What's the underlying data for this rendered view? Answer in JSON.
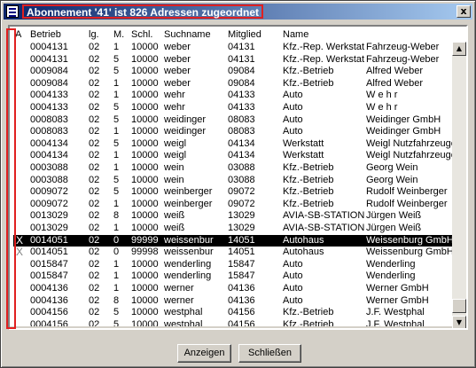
{
  "window": {
    "title": "Abonnement '41' ist 826 Adressen zugeordnet",
    "close_symbol": "x"
  },
  "columns": {
    "a": "A",
    "betrieb": "Betrieb",
    "lg": "lg.",
    "m": "M.",
    "schl": "Schl.",
    "suchname": "Suchname",
    "mitglied": "Mitglied",
    "name": "Name"
  },
  "rows": [
    {
      "a": "",
      "betrieb": "0004131",
      "lg": "02",
      "m": "1",
      "schl": "10000",
      "suchname": "weber",
      "mitglied": "04131",
      "name": "Kfz.-Rep. Werkstat",
      "extra": "Fahrzeug-Weber"
    },
    {
      "a": "",
      "betrieb": "0004131",
      "lg": "02",
      "m": "5",
      "schl": "10000",
      "suchname": "weber",
      "mitglied": "04131",
      "name": "Kfz.-Rep. Werkstat",
      "extra": "Fahrzeug-Weber"
    },
    {
      "a": "",
      "betrieb": "0009084",
      "lg": "02",
      "m": "5",
      "schl": "10000",
      "suchname": "weber",
      "mitglied": "09084",
      "name": "Kfz.-Betrieb",
      "extra": "Alfred Weber"
    },
    {
      "a": "",
      "betrieb": "0009084",
      "lg": "02",
      "m": "1",
      "schl": "10000",
      "suchname": "weber",
      "mitglied": "09084",
      "name": "Kfz.-Betrieb",
      "extra": "Alfred Weber"
    },
    {
      "a": "",
      "betrieb": "0004133",
      "lg": "02",
      "m": "1",
      "schl": "10000",
      "suchname": "wehr",
      "mitglied": "04133",
      "name": "Auto",
      "extra": "W e h r"
    },
    {
      "a": "",
      "betrieb": "0004133",
      "lg": "02",
      "m": "5",
      "schl": "10000",
      "suchname": "wehr",
      "mitglied": "04133",
      "name": "Auto",
      "extra": "W e h r"
    },
    {
      "a": "",
      "betrieb": "0008083",
      "lg": "02",
      "m": "5",
      "schl": "10000",
      "suchname": "weidinger",
      "mitglied": "08083",
      "name": "Auto",
      "extra": "Weidinger GmbH"
    },
    {
      "a": "",
      "betrieb": "0008083",
      "lg": "02",
      "m": "1",
      "schl": "10000",
      "suchname": "weidinger",
      "mitglied": "08083",
      "name": "Auto",
      "extra": "Weidinger GmbH"
    },
    {
      "a": "",
      "betrieb": "0004134",
      "lg": "02",
      "m": "5",
      "schl": "10000",
      "suchname": "weigl",
      "mitglied": "04134",
      "name": "Werkstatt",
      "extra": "Weigl Nutzfahrzeuge"
    },
    {
      "a": "",
      "betrieb": "0004134",
      "lg": "02",
      "m": "1",
      "schl": "10000",
      "suchname": "weigl",
      "mitglied": "04134",
      "name": "Werkstatt",
      "extra": "Weigl Nutzfahrzeuge"
    },
    {
      "a": "",
      "betrieb": "0003088",
      "lg": "02",
      "m": "1",
      "schl": "10000",
      "suchname": "wein",
      "mitglied": "03088",
      "name": "Kfz.-Betrieb",
      "extra": "Georg Wein"
    },
    {
      "a": "",
      "betrieb": "0003088",
      "lg": "02",
      "m": "5",
      "schl": "10000",
      "suchname": "wein",
      "mitglied": "03088",
      "name": "Kfz.-Betrieb",
      "extra": "Georg Wein"
    },
    {
      "a": "",
      "betrieb": "0009072",
      "lg": "02",
      "m": "5",
      "schl": "10000",
      "suchname": "weinberger",
      "mitglied": "09072",
      "name": "Kfz.-Betrieb",
      "extra": "Rudolf Weinberger"
    },
    {
      "a": "",
      "betrieb": "0009072",
      "lg": "02",
      "m": "1",
      "schl": "10000",
      "suchname": "weinberger",
      "mitglied": "09072",
      "name": "Kfz.-Betrieb",
      "extra": "Rudolf Weinberger"
    },
    {
      "a": "",
      "betrieb": "0013029",
      "lg": "02",
      "m": "8",
      "schl": "10000",
      "suchname": "weiß",
      "mitglied": "13029",
      "name": "AVIA-SB-STATION",
      "extra": "Jürgen Weiß"
    },
    {
      "a": "",
      "betrieb": "0013029",
      "lg": "02",
      "m": "1",
      "schl": "10000",
      "suchname": "weiß",
      "mitglied": "13029",
      "name": "AVIA-SB-STATION",
      "extra": "Jürgen Weiß"
    },
    {
      "a": "X",
      "betrieb": "0014051",
      "lg": "02",
      "m": "0",
      "schl": "99999",
      "suchname": "weissenbur",
      "mitglied": "14051",
      "name": "Autohaus",
      "extra": "Weissenburg GmbH",
      "selected": true
    },
    {
      "a": "X",
      "betrieb": "0014051",
      "lg": "02",
      "m": "0",
      "schl": "99998",
      "suchname": "weissenbur",
      "mitglied": "14051",
      "name": "Autohaus",
      "extra": "Weissenburg GmbH"
    },
    {
      "a": "",
      "betrieb": "0015847",
      "lg": "02",
      "m": "1",
      "schl": "10000",
      "suchname": "wenderling",
      "mitglied": "15847",
      "name": "Auto",
      "extra": "Wenderling"
    },
    {
      "a": "",
      "betrieb": "0015847",
      "lg": "02",
      "m": "1",
      "schl": "10000",
      "suchname": "wenderling",
      "mitglied": "15847",
      "name": "Auto",
      "extra": "Wenderling"
    },
    {
      "a": "",
      "betrieb": "0004136",
      "lg": "02",
      "m": "1",
      "schl": "10000",
      "suchname": "werner",
      "mitglied": "04136",
      "name": "Auto",
      "extra": "Werner GmbH"
    },
    {
      "a": "",
      "betrieb": "0004136",
      "lg": "02",
      "m": "8",
      "schl": "10000",
      "suchname": "werner",
      "mitglied": "04136",
      "name": "Auto",
      "extra": "Werner GmbH"
    },
    {
      "a": "",
      "betrieb": "0004156",
      "lg": "02",
      "m": "5",
      "schl": "10000",
      "suchname": "westphal",
      "mitglied": "04156",
      "name": "Kfz.-Betrieb",
      "extra": "J.F. Westphal"
    },
    {
      "a": "",
      "betrieb": "0004156",
      "lg": "02",
      "m": "5",
      "schl": "10000",
      "suchname": "westphal",
      "mitglied": "04156",
      "name": "Kfz.-Betrieb",
      "extra": "J.F. Westphal"
    }
  ],
  "buttons": {
    "anzeigen": "Anzeigen",
    "schliessen": "Schließen"
  },
  "colors": {
    "title_gradient_start": "#0a246a",
    "title_gradient_end": "#a6caf0",
    "highlight_border": "#e02020",
    "selected_row_bg": "#000000"
  },
  "icons": {
    "app": "form-icon",
    "scroll_up": "arrow-up-icon",
    "scroll_down": "arrow-down-icon"
  }
}
